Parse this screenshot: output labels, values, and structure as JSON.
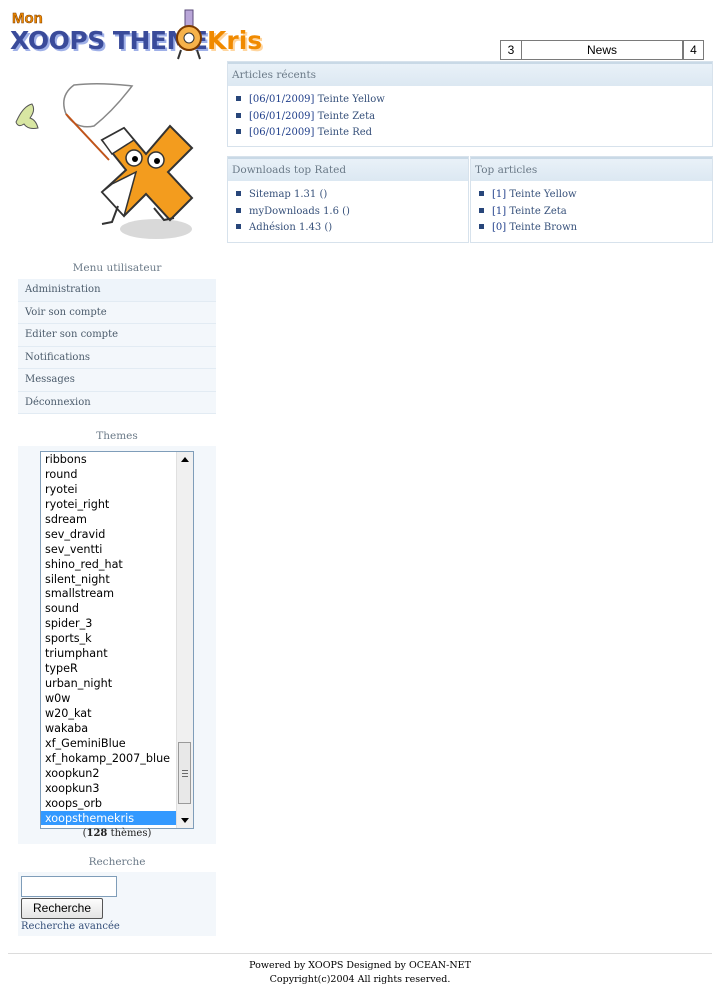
{
  "logo": {
    "mon": "Mon",
    "main": "XOOPS THEME",
    "kris": "Kris"
  },
  "news_nav": {
    "prev": "3",
    "label": "News",
    "next": "4"
  },
  "recent_articles": {
    "title": "Articles récents",
    "items": [
      {
        "date": "[06/01/2009]",
        "label": "Teinte Yellow"
      },
      {
        "date": "[06/01/2009]",
        "label": "Teinte Zeta"
      },
      {
        "date": "[06/01/2009]",
        "label": "Teinte Red"
      }
    ]
  },
  "downloads": {
    "title": "Downloads top Rated",
    "items": [
      "Sitemap 1.31 ()",
      "myDownloads 1.6 ()",
      "Adhésion 1.43 ()"
    ]
  },
  "top_articles": {
    "title": "Top articles",
    "items": [
      {
        "count": "[1]",
        "label": "Teinte Yellow"
      },
      {
        "count": "[1]",
        "label": "Teinte Zeta"
      },
      {
        "count": "[0]",
        "label": "Teinte Brown"
      }
    ]
  },
  "user_menu": {
    "title": "Menu utilisateur",
    "items": [
      "Administration",
      "Voir son compte",
      "Editer son compte",
      "Notifications",
      "Messages",
      "Déconnexion"
    ]
  },
  "themes": {
    "title": "Themes",
    "options": [
      "ribbons",
      "round",
      "ryotei",
      "ryotei_right",
      "sdream",
      "sev_dravid",
      "sev_ventti",
      "shino_red_hat",
      "silent_night",
      "smallstream",
      "sound",
      "spider_3",
      "sports_k",
      "triumphant",
      "typeR",
      "urban_night",
      "w0w",
      "w20_kat",
      "wakaba",
      "xf_GeminiBlue",
      "xf_hokamp_2007_blue",
      "xoopkun2",
      "xoopkun3",
      "xoops_orb",
      "xoopsthemekris"
    ],
    "selected": "xoopsthemekris",
    "count": "128",
    "count_suffix": " thèmes"
  },
  "search": {
    "title": "Recherche",
    "value": "",
    "button": "Recherche",
    "advanced": "Recherche avancée"
  },
  "footer": {
    "line1": "Powered by XOOPS Designed by OCEAN-NET",
    "line2": "Copyright(c)2004 All rights reserved."
  },
  "colors": {
    "accent_orange": "#f08a00",
    "logo_blue": "#3a4b9a",
    "selected": "#3399ff",
    "link": "#36507a"
  }
}
